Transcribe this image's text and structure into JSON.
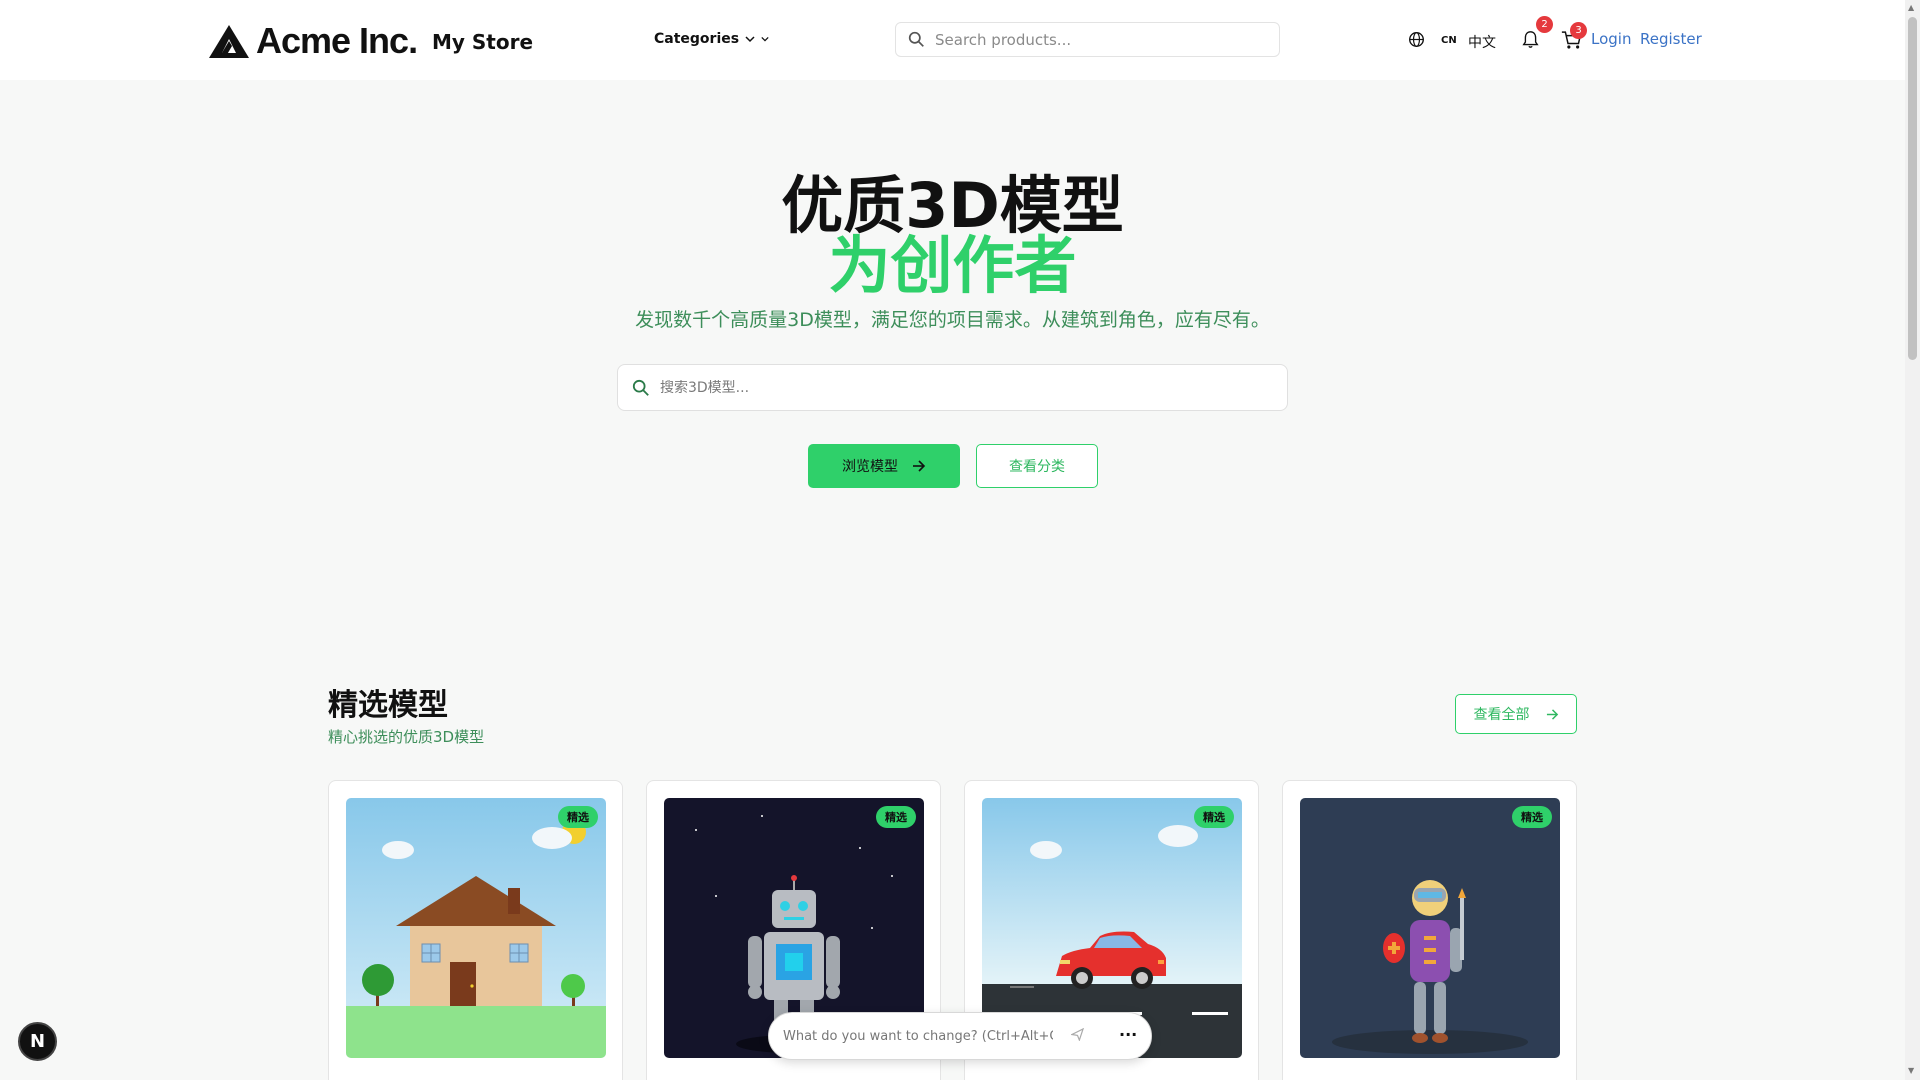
{
  "header": {
    "logo_text": "Acme Inc.",
    "store_name": "My Store",
    "categories_label": "Categories",
    "search_placeholder": "Search products...",
    "lang_code": "CN",
    "language": "中文",
    "notification_count": "2",
    "cart_count": "3",
    "login_label": "Login",
    "register_label": "Register"
  },
  "hero": {
    "title_line1": "优质3D模型",
    "title_line2": "为创作者",
    "subtitle": "发现数千个高质量3D模型，满足您的项目需求。从建筑到角色，应有尽有。",
    "search_placeholder": "搜索3D模型...",
    "browse_label": "浏览模型",
    "categories_label": "查看分类"
  },
  "featured": {
    "title": "精选模型",
    "subtitle": "精心挑选的优质3D模型",
    "view_all_label": "查看全部",
    "cards": [
      {
        "tag": "精选",
        "scene": "house"
      },
      {
        "tag": "精选",
        "scene": "robot"
      },
      {
        "tag": "精选",
        "scene": "car"
      },
      {
        "tag": "精选",
        "scene": "character"
      }
    ]
  },
  "overlay": {
    "framework_badge": "N",
    "ask_placeholder": "What do you want to change? (Ctrl+Alt+C)",
    "more_label": "···"
  },
  "colors": {
    "accent": "#2fd06a",
    "link": "#3b73c6",
    "subtitle_green": "#3d8e5a",
    "badge_red": "#e5393d"
  }
}
